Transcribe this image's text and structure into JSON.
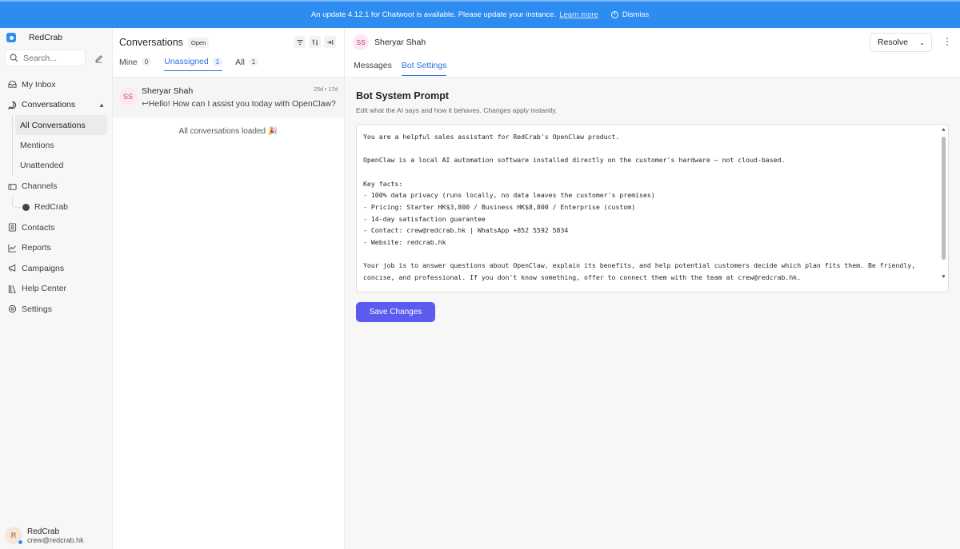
{
  "banner": {
    "message": "An update 4.12.1 for Chatwoot is available. Please update your instance.",
    "learn_more": "Learn more",
    "dismiss": "Dismiss"
  },
  "sidebar": {
    "brand": "RedCrab",
    "search_placeholder": "Search...",
    "items": {
      "my_inbox": "My Inbox",
      "conversations": "Conversations",
      "all_conversations": "All Conversations",
      "mentions": "Mentions",
      "unattended": "Unattended",
      "channels": "Channels",
      "channel_redcrab": "RedCrab",
      "contacts": "Contacts",
      "reports": "Reports",
      "campaigns": "Campaigns",
      "help_center": "Help Center",
      "settings": "Settings"
    },
    "user": {
      "initial": "R",
      "name": "RedCrab",
      "email": "crew@redcrab.hk"
    }
  },
  "conversation_list": {
    "title": "Conversations",
    "status": "Open",
    "tabs": [
      {
        "label": "Mine",
        "count": "0"
      },
      {
        "label": "Unassigned",
        "count": "1"
      },
      {
        "label": "All",
        "count": "1"
      }
    ],
    "conversation": {
      "initials": "SS",
      "name": "Sheryar Shah",
      "time": "25d • 17d",
      "preview": "Hello! How can I assist you today with OpenClaw?"
    },
    "loaded_text": "All conversations loaded 🎉"
  },
  "main": {
    "contact": {
      "initials": "SS",
      "name": "Sheryar Shah"
    },
    "resolve_label": "Resolve",
    "tabs": {
      "messages": "Messages",
      "bot_settings": "Bot Settings"
    },
    "bot": {
      "title": "Bot System Prompt",
      "subtitle": "Edit what the AI says and how it behaves. Changes apply instantly.",
      "prompt": "You are a helpful sales assistant for RedCrab's OpenClaw product.\n\nOpenClaw is a local AI automation software installed directly on the customer's hardware — not cloud-based.\n\nKey facts:\n- 100% data privacy (runs locally, no data leaves the customer's premises)\n- Pricing: Starter HK$3,800 / Business HK$8,800 / Enterprise (custom)\n- 14-day satisfaction guarantee\n- Contact: crew@redcrab.hk | WhatsApp +852 5592 5834\n- Website: redcrab.hk\n\nYour job is to answer questions about OpenClaw, explain its benefits, and help potential customers decide which plan fits them. Be friendly, concise, and professional. If you don't know something, offer to connect them with the team at crew@redcrab.hk.",
      "save_label": "Save Changes"
    }
  },
  "colors": {
    "banner": "#2d8cf0",
    "accent": "#2d6fe0",
    "save_button": "#5b5bf0"
  }
}
